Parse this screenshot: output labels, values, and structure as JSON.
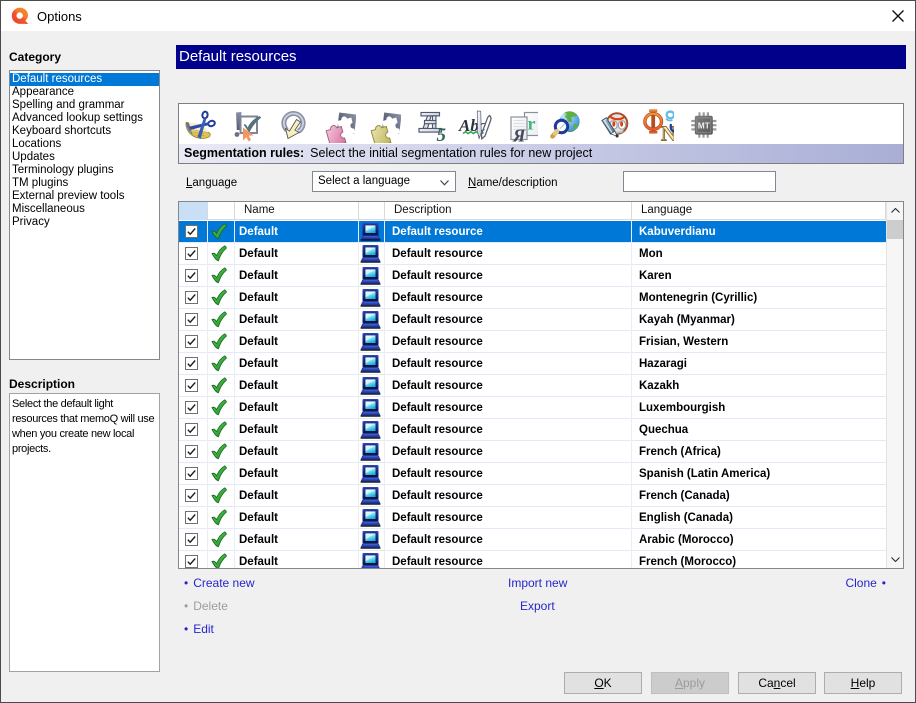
{
  "window": {
    "title": "Options"
  },
  "sidebar": {
    "category_label": "Category",
    "items": [
      {
        "label": "Default resources",
        "selected": true
      },
      {
        "label": "Appearance",
        "selected": false
      },
      {
        "label": "Spelling and grammar",
        "selected": false
      },
      {
        "label": "Advanced lookup settings",
        "selected": false
      },
      {
        "label": "Keyboard shortcuts",
        "selected": false
      },
      {
        "label": "Locations",
        "selected": false
      },
      {
        "label": "Updates",
        "selected": false
      },
      {
        "label": "Terminology plugins",
        "selected": false
      },
      {
        "label": "TM plugins",
        "selected": false
      },
      {
        "label": "External preview tools",
        "selected": false
      },
      {
        "label": "Miscellaneous",
        "selected": false
      },
      {
        "label": "Privacy",
        "selected": false
      }
    ],
    "description_label": "Description",
    "description_text": "Select the default light resources that memoQ will use when you create new local projects."
  },
  "main": {
    "header": "Default resources",
    "toolbar": {
      "icons": [
        "segmentation-rules-icon",
        "qa-settings-icon",
        "auto-translation-rules-icon",
        "filters-pink-puzzle-icon",
        "filters-yellow-puzzle-icon",
        "number-formats-icon",
        "autocorrect-icon",
        "export-font-icon",
        "web-search-icon",
        "ignore-lists-icon",
        "non-translatables-icon",
        "mt-settings-icon"
      ],
      "glyphs": {
        "five": "五",
        "five_num": "5",
        "ab": "Ab",
        "cedilla": "ç",
        "ya": "Я",
        "r": "r",
        "phi": "Φ",
        "n": "N",
        "b": "b",
        "mt": "MT"
      },
      "caption_bold": "Segmentation rules:",
      "caption_text": "Select the initial segmentation rules for new project"
    },
    "filters": {
      "language_label": "Language",
      "language_value": "Select a language",
      "name_label": "Name/description",
      "name_value": ""
    },
    "table": {
      "columns": {
        "name": "Name",
        "description": "Description",
        "language": "Language"
      },
      "rows": [
        {
          "checked": true,
          "name": "Default",
          "description": "Default resource",
          "language": "Kabuverdianu",
          "selected": true
        },
        {
          "checked": true,
          "name": "Default",
          "description": "Default resource",
          "language": "Mon",
          "selected": false
        },
        {
          "checked": true,
          "name": "Default",
          "description": "Default resource",
          "language": "Karen",
          "selected": false
        },
        {
          "checked": true,
          "name": "Default",
          "description": "Default resource",
          "language": "Montenegrin (Cyrillic)",
          "selected": false
        },
        {
          "checked": true,
          "name": "Default",
          "description": "Default resource",
          "language": "Kayah (Myanmar)",
          "selected": false
        },
        {
          "checked": true,
          "name": "Default",
          "description": "Default resource",
          "language": "Frisian, Western",
          "selected": false
        },
        {
          "checked": true,
          "name": "Default",
          "description": "Default resource",
          "language": "Hazaragi",
          "selected": false
        },
        {
          "checked": true,
          "name": "Default",
          "description": "Default resource",
          "language": "Kazakh",
          "selected": false
        },
        {
          "checked": true,
          "name": "Default",
          "description": "Default resource",
          "language": "Luxembourgish",
          "selected": false
        },
        {
          "checked": true,
          "name": "Default",
          "description": "Default resource",
          "language": "Quechua",
          "selected": false
        },
        {
          "checked": true,
          "name": "Default",
          "description": "Default resource",
          "language": "French (Africa)",
          "selected": false
        },
        {
          "checked": true,
          "name": "Default",
          "description": "Default resource",
          "language": "Spanish (Latin America)",
          "selected": false
        },
        {
          "checked": true,
          "name": "Default",
          "description": "Default resource",
          "language": "French (Canada)",
          "selected": false
        },
        {
          "checked": true,
          "name": "Default",
          "description": "Default resource",
          "language": "English (Canada)",
          "selected": false
        },
        {
          "checked": true,
          "name": "Default",
          "description": "Default resource",
          "language": "Arabic (Morocco)",
          "selected": false
        },
        {
          "checked": true,
          "name": "Default",
          "description": "Default resource",
          "language": "French (Morocco)",
          "selected": false
        }
      ]
    },
    "links": {
      "create_new": "Create new",
      "delete": "Delete",
      "edit": "Edit",
      "import_new": "Import new",
      "export": "Export",
      "clone": "Clone"
    },
    "buttons": {
      "ok": "OK",
      "apply": "Apply",
      "cancel": "Cancel",
      "help": "Help"
    }
  },
  "colors": {
    "header_navy": "#00008b",
    "selection_blue": "#0078d7",
    "link_blue": "#2626cd",
    "caption_gradient_left": "#e9eaf5",
    "caption_gradient_right": "#a9aed6"
  }
}
